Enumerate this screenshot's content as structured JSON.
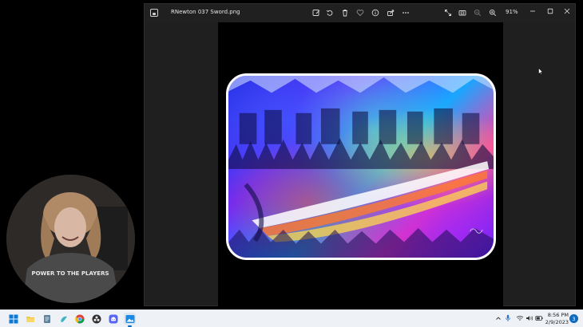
{
  "window": {
    "file_name": "RNewton 037 Sword.png",
    "zoom_level": "91%",
    "toolbar_icons": [
      "edit-icon",
      "rotate-icon",
      "delete-icon",
      "favorite-icon",
      "info-icon",
      "share-icon",
      "more-icon"
    ],
    "view_icons": [
      "expand-icon",
      "slideshow-icon",
      "zoom-out-icon",
      "zoom-in-icon"
    ],
    "controls": [
      "minimize-icon",
      "maximize-icon",
      "close-icon"
    ]
  },
  "webcam": {
    "shirt_text": "POWER TO THE PLAYERS"
  },
  "taskbar": {
    "apps": [
      "windows-start-icon",
      "file-explorer-icon",
      "notepad-icon",
      "app-bird-icon",
      "chrome-icon",
      "obs-icon",
      "discord-icon",
      "photos-icon"
    ],
    "tray_icons": [
      "chevron-up-icon",
      "microphone-icon",
      "wifi-icon",
      "volume-icon",
      "battery-icon"
    ],
    "time": "8:56 PM",
    "date": "2/9/2023",
    "notification_count": "3"
  },
  "colors": {
    "window_bg": "#1f1f1f",
    "taskbar_bg": "#eef1f6",
    "accent": "#0067c0"
  }
}
